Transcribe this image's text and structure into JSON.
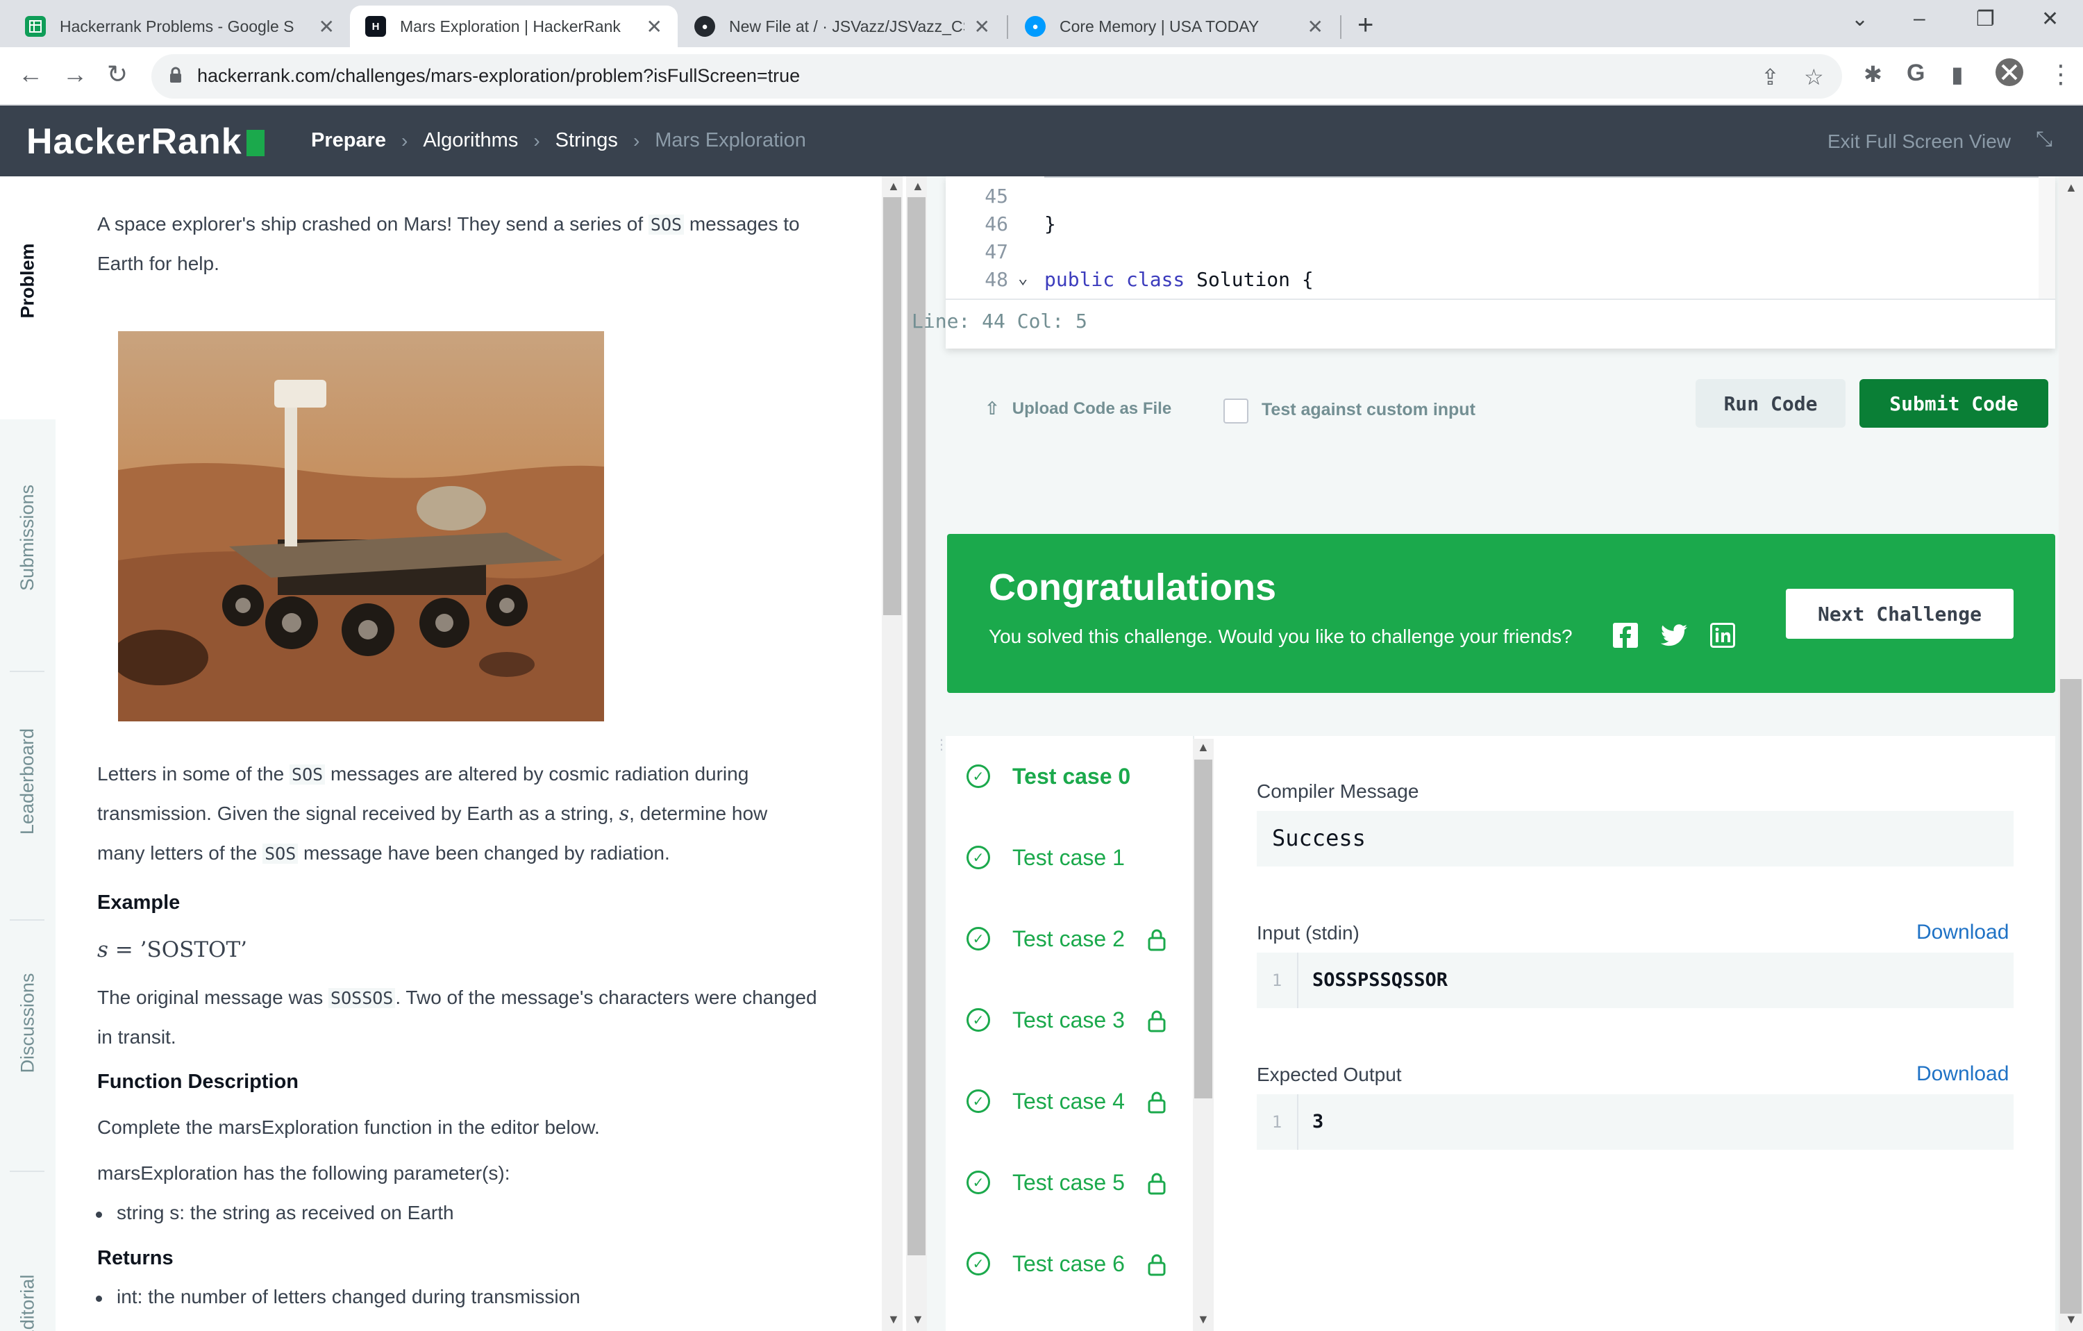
{
  "browser": {
    "tabs": [
      {
        "title": "Hackerrank Problems - Google S",
        "favicon": "sheets-icon",
        "color": "#0f9d58"
      },
      {
        "title": "Mars Exploration | HackerRank",
        "favicon": "hackerrank-icon",
        "color": "#0e141e"
      },
      {
        "title": "New File at / · JSVazz/JSVazz_CS",
        "favicon": "github-icon",
        "color": "#24292f"
      },
      {
        "title": "Core Memory | USA TODAY",
        "favicon": "usatoday-icon",
        "color": "#009bff"
      }
    ],
    "url": "hackerrank.com/challenges/mars-exploration/problem?isFullScreen=true"
  },
  "header": {
    "logo": "HackerRank",
    "breadcrumb": [
      "Prepare",
      "Algorithms",
      "Strings",
      "Mars Exploration"
    ],
    "exit_fullscreen": "Exit Full Screen View"
  },
  "vtabs": [
    "Problem",
    "Submissions",
    "Leaderboard",
    "Discussions",
    "Editorial"
  ],
  "problem": {
    "intro_a": "A space explorer's ship crashed on Mars! They send a series of ",
    "sos": "SOS",
    "intro_b": " messages to",
    "intro_c": "Earth for help.",
    "para2_a": "Letters in some of the ",
    "para2_b": " messages are altered by cosmic radiation during",
    "para2_c": "transmission. Given the signal received by Earth as a string, ",
    "var_s": "s",
    "para2_d": ", determine how",
    "para2_e": "many letters of the ",
    "para2_f": " message have been changed by radiation.",
    "example_heading": "Example",
    "example_eq_lhs": "s",
    "example_eq_rhs": " = ’SOSTOT’",
    "example_desc_a": "The original message was ",
    "example_mono": "SOSSOS",
    "example_desc_b": ". Two of the message's characters were changed",
    "example_desc_c": "in transit.",
    "func_heading": "Function Description",
    "func_desc": "Complete the marsExploration function in the editor below.",
    "params_intro": "marsExploration has the following parameter(s):",
    "param_1": "string s: the string as received on Earth",
    "returns_heading": "Returns",
    "return_1": "int: the number of letters changed during transmission"
  },
  "editor": {
    "lines": [
      {
        "n": "45",
        "code": ""
      },
      {
        "n": "46",
        "code": "}"
      },
      {
        "n": "47",
        "code": ""
      },
      {
        "n": "48",
        "kw": "public class",
        "code": " Solution {"
      }
    ],
    "status": "Line: 44 Col: 5"
  },
  "actions": {
    "upload": "Upload Code as File",
    "custom_input": "Test against custom input",
    "run": "Run Code",
    "submit": "Submit Code"
  },
  "congrats": {
    "title": "Congratulations",
    "subtitle": "You solved this challenge. Would you like to challenge your friends?",
    "next": "Next Challenge",
    "color": "#1ba94c"
  },
  "testcases": [
    {
      "label": "Test case 0",
      "locked": false
    },
    {
      "label": "Test case 1",
      "locked": false
    },
    {
      "label": "Test case 2",
      "locked": true
    },
    {
      "label": "Test case 3",
      "locked": true
    },
    {
      "label": "Test case 4",
      "locked": true
    },
    {
      "label": "Test case 5",
      "locked": true
    },
    {
      "label": "Test case 6",
      "locked": true
    }
  ],
  "results": {
    "compiler_label": "Compiler Message",
    "compiler_value": "Success",
    "input_label": "Input (stdin)",
    "input_line": "1",
    "input_value": "SOSSPSSQSSOR",
    "output_label": "Expected Output",
    "output_line": "1",
    "output_value": "3",
    "download": "Download"
  }
}
